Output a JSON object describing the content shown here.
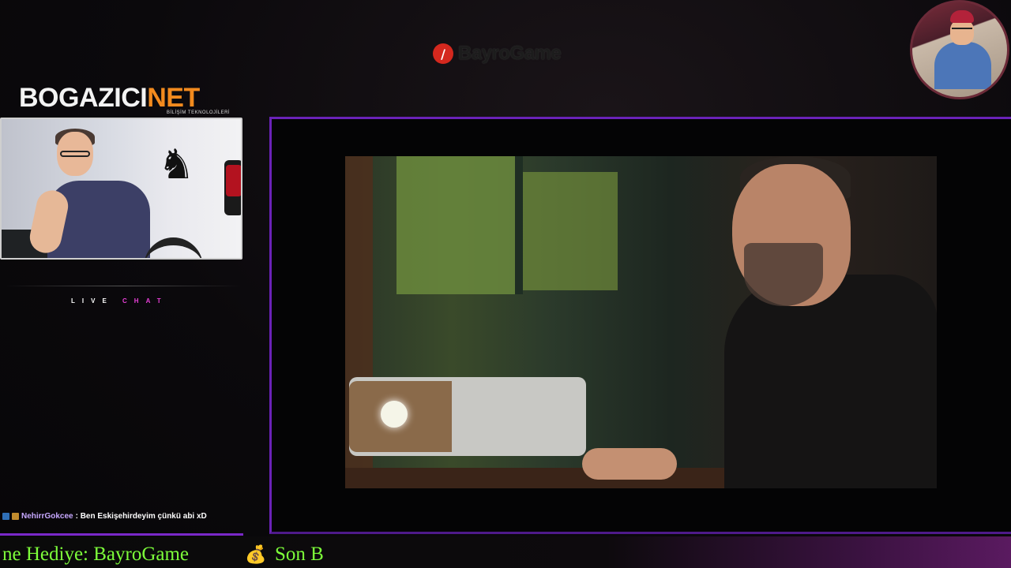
{
  "top_logo": {
    "mark": "/",
    "word": "BayroGame"
  },
  "brand": {
    "part1": "BOGAZICI",
    "part2": "NET",
    "subtitle": "BİLİŞİM TEKNOLOJİLERİ"
  },
  "live_chat": {
    "word1": "LIVE",
    "word2": "CHAT"
  },
  "chat": {
    "messages": [
      {
        "user": "NehirrGokcee",
        "text": ": Ben Eskişehirdeyim çünkü abi xD"
      }
    ]
  },
  "ticker": {
    "segment1": "ne Hediye: BayroGame",
    "icon": "money-bag-icon",
    "segment2": "Son B"
  },
  "colors": {
    "accent_purple": "#6a22b8",
    "ticker_green": "#7dff3a",
    "brand_orange": "#f28a1e",
    "chat_pink": "#e83fd8"
  }
}
